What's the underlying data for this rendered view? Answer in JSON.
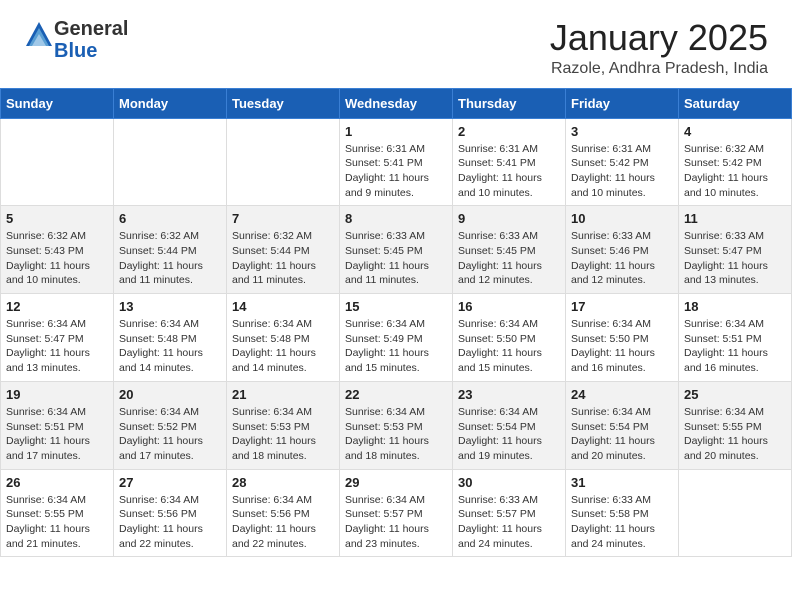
{
  "header": {
    "logo_general": "General",
    "logo_blue": "Blue",
    "month_title": "January 2025",
    "location": "Razole, Andhra Pradesh, India"
  },
  "days_of_week": [
    "Sunday",
    "Monday",
    "Tuesday",
    "Wednesday",
    "Thursday",
    "Friday",
    "Saturday"
  ],
  "weeks": [
    [
      {
        "day": "",
        "info": ""
      },
      {
        "day": "",
        "info": ""
      },
      {
        "day": "",
        "info": ""
      },
      {
        "day": "1",
        "info": "Sunrise: 6:31 AM\nSunset: 5:41 PM\nDaylight: 11 hours\nand 9 minutes."
      },
      {
        "day": "2",
        "info": "Sunrise: 6:31 AM\nSunset: 5:41 PM\nDaylight: 11 hours\nand 10 minutes."
      },
      {
        "day": "3",
        "info": "Sunrise: 6:31 AM\nSunset: 5:42 PM\nDaylight: 11 hours\nand 10 minutes."
      },
      {
        "day": "4",
        "info": "Sunrise: 6:32 AM\nSunset: 5:42 PM\nDaylight: 11 hours\nand 10 minutes."
      }
    ],
    [
      {
        "day": "5",
        "info": "Sunrise: 6:32 AM\nSunset: 5:43 PM\nDaylight: 11 hours\nand 10 minutes."
      },
      {
        "day": "6",
        "info": "Sunrise: 6:32 AM\nSunset: 5:44 PM\nDaylight: 11 hours\nand 11 minutes."
      },
      {
        "day": "7",
        "info": "Sunrise: 6:32 AM\nSunset: 5:44 PM\nDaylight: 11 hours\nand 11 minutes."
      },
      {
        "day": "8",
        "info": "Sunrise: 6:33 AM\nSunset: 5:45 PM\nDaylight: 11 hours\nand 11 minutes."
      },
      {
        "day": "9",
        "info": "Sunrise: 6:33 AM\nSunset: 5:45 PM\nDaylight: 11 hours\nand 12 minutes."
      },
      {
        "day": "10",
        "info": "Sunrise: 6:33 AM\nSunset: 5:46 PM\nDaylight: 11 hours\nand 12 minutes."
      },
      {
        "day": "11",
        "info": "Sunrise: 6:33 AM\nSunset: 5:47 PM\nDaylight: 11 hours\nand 13 minutes."
      }
    ],
    [
      {
        "day": "12",
        "info": "Sunrise: 6:34 AM\nSunset: 5:47 PM\nDaylight: 11 hours\nand 13 minutes."
      },
      {
        "day": "13",
        "info": "Sunrise: 6:34 AM\nSunset: 5:48 PM\nDaylight: 11 hours\nand 14 minutes."
      },
      {
        "day": "14",
        "info": "Sunrise: 6:34 AM\nSunset: 5:48 PM\nDaylight: 11 hours\nand 14 minutes."
      },
      {
        "day": "15",
        "info": "Sunrise: 6:34 AM\nSunset: 5:49 PM\nDaylight: 11 hours\nand 15 minutes."
      },
      {
        "day": "16",
        "info": "Sunrise: 6:34 AM\nSunset: 5:50 PM\nDaylight: 11 hours\nand 15 minutes."
      },
      {
        "day": "17",
        "info": "Sunrise: 6:34 AM\nSunset: 5:50 PM\nDaylight: 11 hours\nand 16 minutes."
      },
      {
        "day": "18",
        "info": "Sunrise: 6:34 AM\nSunset: 5:51 PM\nDaylight: 11 hours\nand 16 minutes."
      }
    ],
    [
      {
        "day": "19",
        "info": "Sunrise: 6:34 AM\nSunset: 5:51 PM\nDaylight: 11 hours\nand 17 minutes."
      },
      {
        "day": "20",
        "info": "Sunrise: 6:34 AM\nSunset: 5:52 PM\nDaylight: 11 hours\nand 17 minutes."
      },
      {
        "day": "21",
        "info": "Sunrise: 6:34 AM\nSunset: 5:53 PM\nDaylight: 11 hours\nand 18 minutes."
      },
      {
        "day": "22",
        "info": "Sunrise: 6:34 AM\nSunset: 5:53 PM\nDaylight: 11 hours\nand 18 minutes."
      },
      {
        "day": "23",
        "info": "Sunrise: 6:34 AM\nSunset: 5:54 PM\nDaylight: 11 hours\nand 19 minutes."
      },
      {
        "day": "24",
        "info": "Sunrise: 6:34 AM\nSunset: 5:54 PM\nDaylight: 11 hours\nand 20 minutes."
      },
      {
        "day": "25",
        "info": "Sunrise: 6:34 AM\nSunset: 5:55 PM\nDaylight: 11 hours\nand 20 minutes."
      }
    ],
    [
      {
        "day": "26",
        "info": "Sunrise: 6:34 AM\nSunset: 5:55 PM\nDaylight: 11 hours\nand 21 minutes."
      },
      {
        "day": "27",
        "info": "Sunrise: 6:34 AM\nSunset: 5:56 PM\nDaylight: 11 hours\nand 22 minutes."
      },
      {
        "day": "28",
        "info": "Sunrise: 6:34 AM\nSunset: 5:56 PM\nDaylight: 11 hours\nand 22 minutes."
      },
      {
        "day": "29",
        "info": "Sunrise: 6:34 AM\nSunset: 5:57 PM\nDaylight: 11 hours\nand 23 minutes."
      },
      {
        "day": "30",
        "info": "Sunrise: 6:33 AM\nSunset: 5:57 PM\nDaylight: 11 hours\nand 24 minutes."
      },
      {
        "day": "31",
        "info": "Sunrise: 6:33 AM\nSunset: 5:58 PM\nDaylight: 11 hours\nand 24 minutes."
      },
      {
        "day": "",
        "info": ""
      }
    ]
  ]
}
